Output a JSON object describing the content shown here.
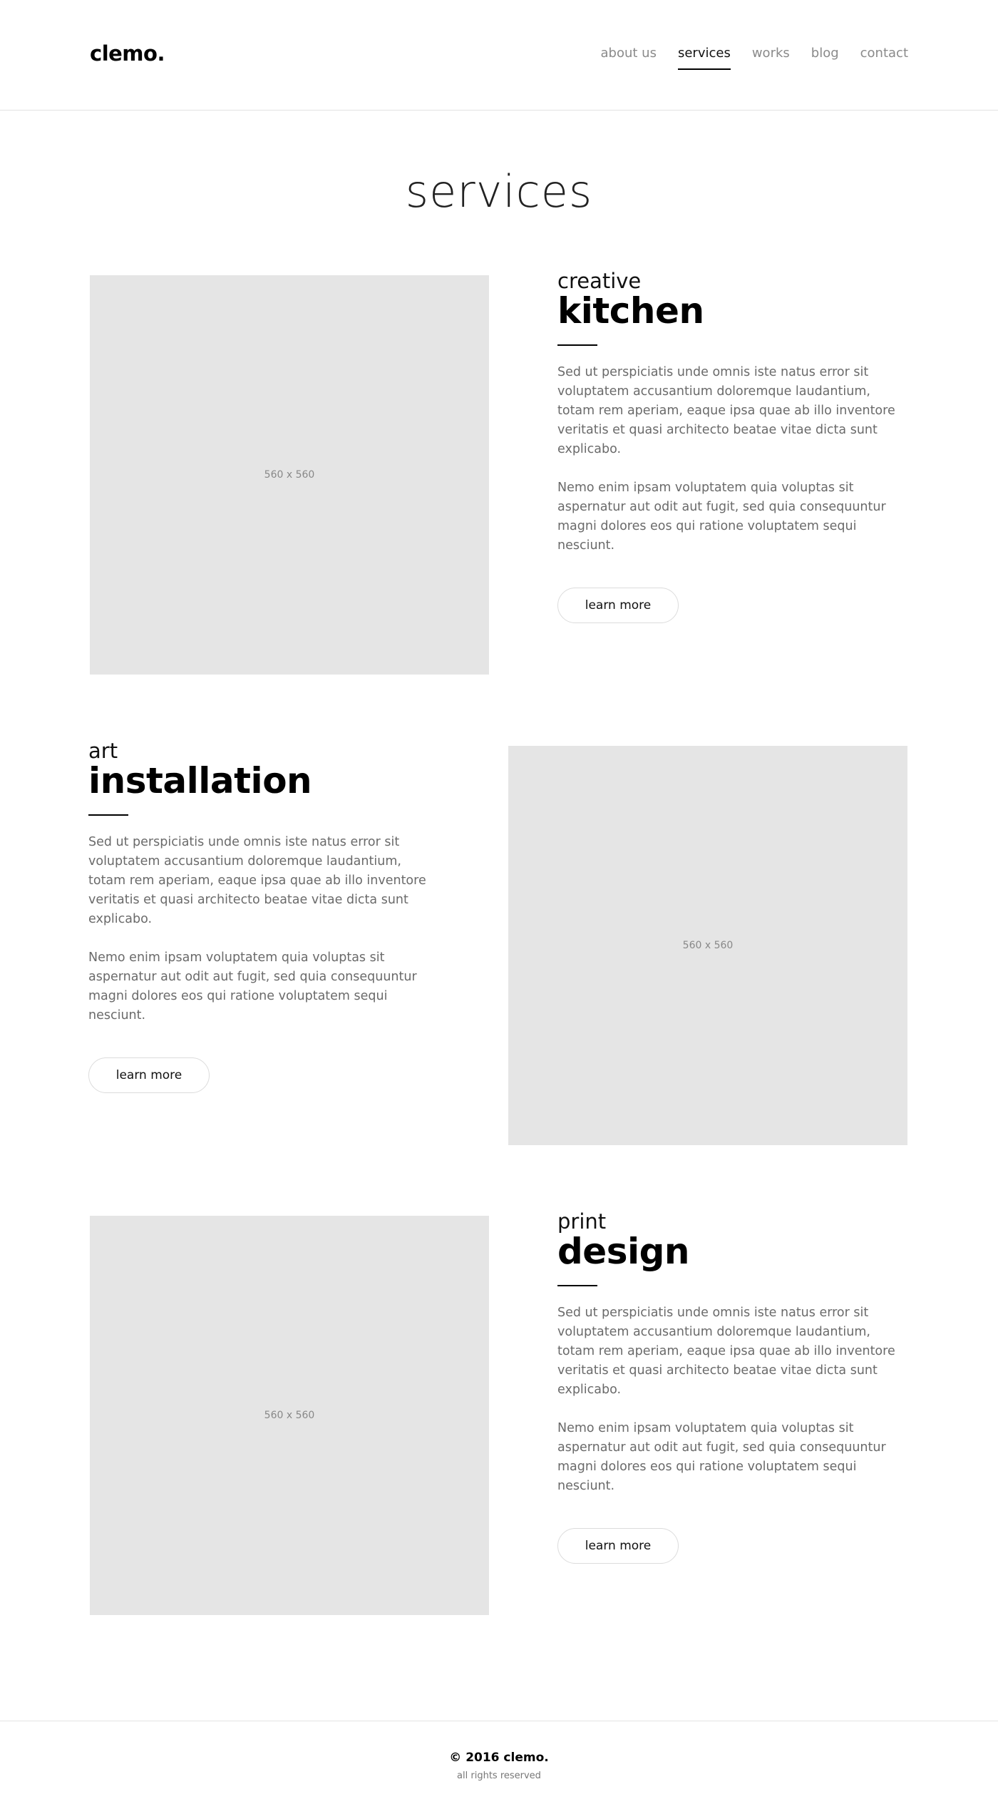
{
  "brand": {
    "logo": "clemo."
  },
  "nav": {
    "items": [
      {
        "label": "about us",
        "active": false
      },
      {
        "label": "services",
        "active": true
      },
      {
        "label": "works",
        "active": false
      },
      {
        "label": "blog",
        "active": false
      },
      {
        "label": "contact",
        "active": false
      }
    ]
  },
  "page": {
    "title": "services"
  },
  "services": [
    {
      "small": "creative",
      "big": "kitchen",
      "image_label": "560 x 560",
      "para1": "Sed ut perspiciatis unde omnis iste natus error sit voluptatem accusantium doloremque laudantium, totam rem aperiam, eaque ipsa quae ab illo inventore veritatis et quasi architecto beatae vitae dicta sunt explicabo.",
      "para2": "Nemo enim ipsam voluptatem quia voluptas sit aspernatur aut odit aut fugit, sed quia consequuntur magni dolores eos qui ratione voluptatem sequi nesciunt.",
      "button": "learn more"
    },
    {
      "small": "art",
      "big": "installation",
      "image_label": "560 x 560",
      "para1": "Sed ut perspiciatis unde omnis iste natus error sit voluptatem accusantium doloremque laudantium, totam rem aperiam, eaque ipsa quae ab illo inventore veritatis et quasi architecto beatae vitae dicta sunt explicabo.",
      "para2": "Nemo enim ipsam voluptatem quia voluptas sit aspernatur aut odit aut fugit, sed quia consequuntur magni dolores eos qui ratione voluptatem sequi nesciunt.",
      "button": "learn more"
    },
    {
      "small": "print",
      "big": "design",
      "image_label": "560 x 560",
      "para1": "Sed ut perspiciatis unde omnis iste natus error sit voluptatem accusantium doloremque laudantium, totam rem aperiam, eaque ipsa quae ab illo inventore veritatis et quasi architecto beatae vitae dicta sunt explicabo.",
      "para2": "Nemo enim ipsam voluptatem quia voluptas sit aspernatur aut odit aut fugit, sed quia consequuntur magni dolores eos qui ratione voluptatem sequi nesciunt.",
      "button": "learn more"
    }
  ],
  "footer": {
    "copyright": "© 2016 clemo.",
    "rights": "all rights reserved"
  },
  "colors": {
    "placeholder_bg": "#e5e5e5",
    "text_muted": "#6a6a6a",
    "nav_inactive": "#8a8a8a"
  }
}
